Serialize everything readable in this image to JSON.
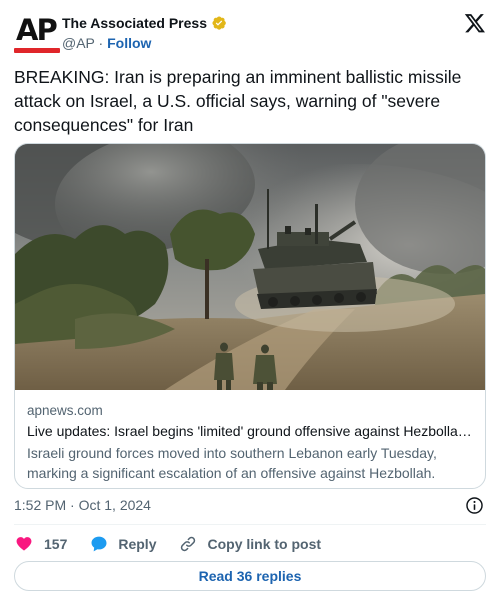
{
  "author": {
    "name": "The Associated Press",
    "handle": "@AP",
    "separator": " · ",
    "follow_label": "Follow",
    "avatar_text": "AP",
    "verified_color": "#e2b719",
    "avatar_bar_color": "#e0262a"
  },
  "tweet": {
    "text": "BREAKING: Iran is preparing an imminent ballistic missile attack on Israel, a U.S. official says, warning of \"severe consequences\" for Iran",
    "timestamp": "1:52 PM · Oct 1, 2024"
  },
  "link_card": {
    "domain": "apnews.com",
    "title": "Live updates: Israel begins 'limited' ground offensive against Hezbollah …",
    "description": "Israeli ground forces moved into southern Lebanon early Tuesday, marking a significant escalation of an offensive against Hezbollah."
  },
  "actions": {
    "likes_count": "157",
    "reply_label": "Reply",
    "copy_link_label": "Copy link to post"
  },
  "replies_button": {
    "label": "Read 36 replies"
  },
  "colors": {
    "accent": "#1d64b0",
    "like": "#f91880",
    "reply_icon": "#1d9bf0",
    "muted": "#536471"
  },
  "icons": {
    "platform": "x-logo-icon",
    "verified": "verified-badge-icon",
    "info": "info-icon",
    "like": "heart-icon",
    "reply": "speech-bubble-icon",
    "copy_link": "link-icon"
  }
}
